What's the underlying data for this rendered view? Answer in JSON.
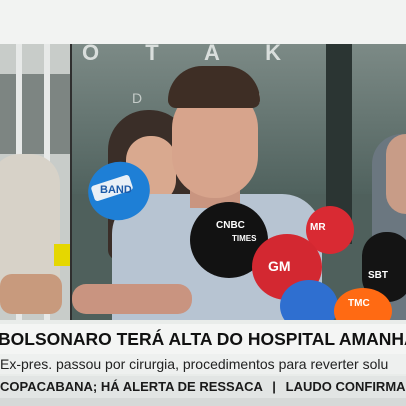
{
  "video": {
    "building_sign_top": "O T A K",
    "building_sign_bottom": "D E   D I",
    "mic_labels": {
      "band": "BAND",
      "cnn": "CNBC",
      "times": "TIMES",
      "mr": "MR",
      "globo": "GM",
      "tmc": "TMC",
      "sbt": "SBT"
    }
  },
  "lower_third": {
    "headline": "BOLSONARO TERÁ ALTA DO HOSPITAL AMANHÃ, DIZ B",
    "subline": "Ex-pres. passou por cirurgia, procedimentos para reverter solu",
    "ticker": {
      "items": [
        "COPACABANA; HÁ ALERTA DE RESSACA",
        "LAUDO CONFIRMA INT"
      ]
    }
  },
  "colors": {
    "headline_bg": "#f4f5f4",
    "ticker_bg": "#e2e5e4",
    "mic_red": "#d32831",
    "mic_blue": "#1e7fd6",
    "mic_orange": "#ff6a13"
  }
}
